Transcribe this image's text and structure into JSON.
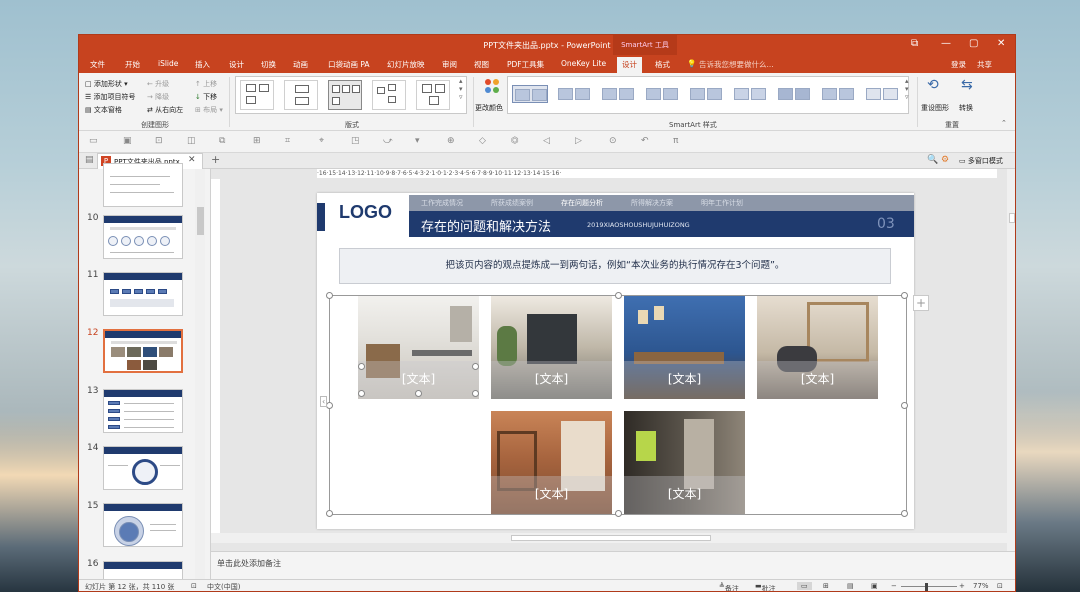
{
  "window": {
    "title": "PPT文件夹出品.pptx - PowerPoint",
    "context_tab": "SmartArt 工具",
    "controls": [
      "⧉",
      "—",
      "▢",
      "✕"
    ]
  },
  "tabs": [
    "文件",
    "开始",
    "iSlide",
    "插入",
    "设计",
    "切换",
    "动画",
    "口袋动画 PA",
    "幻灯片放映",
    "审阅",
    "视图",
    "PDF工具集",
    "OneKey Lite",
    "设计",
    "格式"
  ],
  "tell_me": "告诉我您想要做什么...",
  "account": {
    "login": "登录",
    "share": "共享"
  },
  "ribbon": {
    "create": {
      "items": [
        "添加形状",
        "添加项目符号",
        "文本窗格",
        "升级",
        "降级",
        "从右向左",
        "上移",
        "下移",
        "布局"
      ],
      "label": "创建图形"
    },
    "layouts_label": "版式",
    "change_color": "更改颜色",
    "styles_label": "SmartArt 样式",
    "reset": {
      "items": [
        "重设图形",
        "转换"
      ],
      "label": "重置"
    }
  },
  "doc_tab": "PPT文件夹出品.pptx",
  "view_options": "多窗口模式",
  "thumbnails": [
    {
      "num": "10"
    },
    {
      "num": "11"
    },
    {
      "num": "12"
    },
    {
      "num": "13"
    },
    {
      "num": "14"
    },
    {
      "num": "15"
    },
    {
      "num": "16"
    }
  ],
  "ruler_text": "·16·15·14·13·12·11·10·9·8·7·6·5·4·3·2·1·0·1·2·3·4·5·6·7·8·9·10·11·12·13·14·15·16·",
  "slide": {
    "logo": "LOGO",
    "nav": [
      "工作完成情况",
      "所获成绩案例",
      "存在问题分析",
      "所得解决方案",
      "明年工作计划"
    ],
    "title": "存在的问题和解决方法",
    "subtitle": "2019XIAOSHOUSHUJUHUIZONG",
    "page_no": "03",
    "statement": "把该页内容的观点提炼成一到两句话，例如“本次业务的执行情况存在3个问题”。",
    "smartart_placeholder": "[文本]"
  },
  "notes_placeholder": "单击此处添加备注",
  "status": {
    "slide_info": "幻灯片 第 12 张，共 110 张",
    "language": "中文(中国)",
    "notes": "备注",
    "comments": "批注",
    "zoom": "77%"
  },
  "colors": {
    "accent": "#c7431f",
    "slide_navy": "#1f3a6e",
    "nav_gray": "#8d97a9"
  }
}
